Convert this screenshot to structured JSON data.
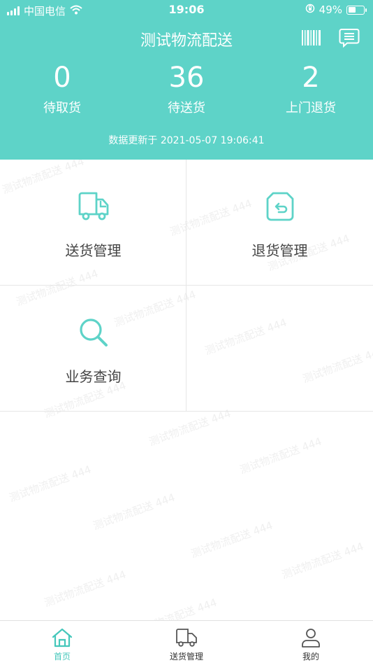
{
  "status_bar": {
    "carrier": "中国电信",
    "time": "19:06",
    "battery": "49%",
    "battery_level": 0.49
  },
  "header": {
    "title": "测试物流配送",
    "scan_icon": "barcode-icon",
    "message_icon": "message-list-icon"
  },
  "stats": [
    {
      "value": "0",
      "label": "待取货"
    },
    {
      "value": "36",
      "label": "待送货"
    },
    {
      "value": "2",
      "label": "上门退货"
    }
  ],
  "updated_text": "数据更新于 2021-05-07 19:06:41",
  "menu": [
    {
      "label": "送货管理",
      "icon": "delivery-truck-icon"
    },
    {
      "label": "退货管理",
      "icon": "return-box-icon"
    },
    {
      "label": "业务查询",
      "icon": "search-icon"
    }
  ],
  "watermark": {
    "text": "测试物流配送",
    "code": "444"
  },
  "tabs": [
    {
      "label": "首页",
      "icon": "home-icon",
      "active": true
    },
    {
      "label": "送货管理",
      "icon": "truck-icon",
      "active": false
    },
    {
      "label": "我的",
      "icon": "user-icon",
      "active": false
    }
  ],
  "colors": {
    "brand": "#5ed3c8",
    "accent": "#45c7bb",
    "text": "#444444"
  }
}
